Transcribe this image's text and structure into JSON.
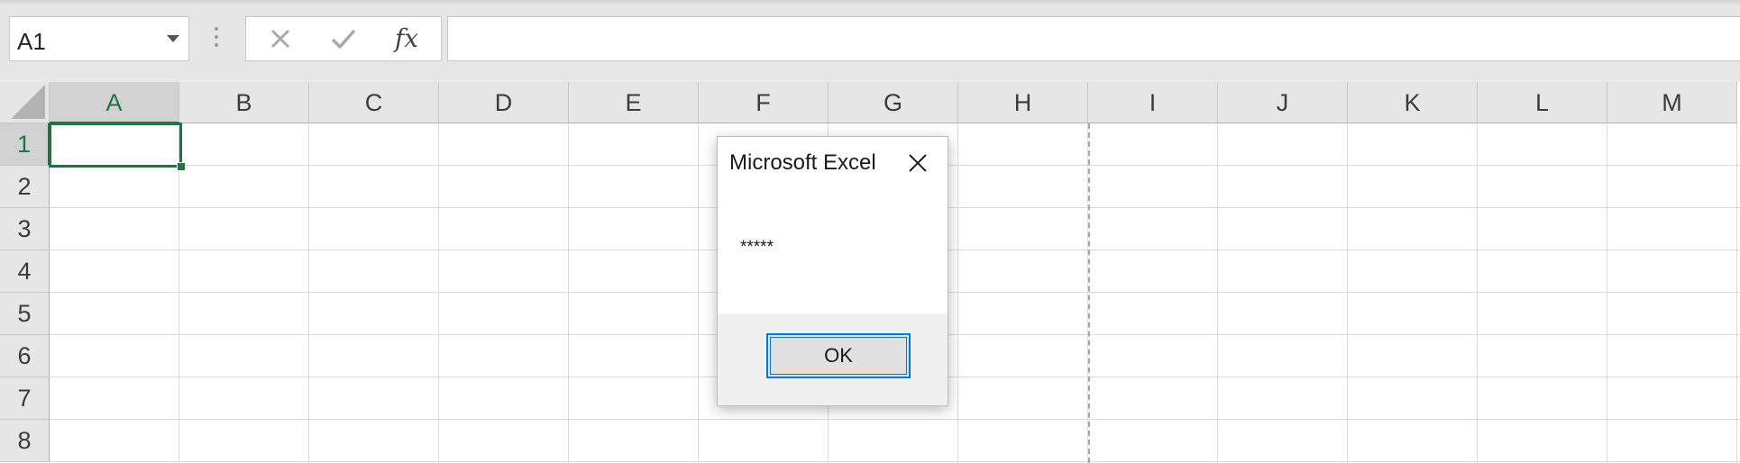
{
  "formula_bar": {
    "name_box_value": "A1",
    "cancel_icon": "close-icon",
    "enter_icon": "check-icon",
    "function_label": "fx",
    "formula_value": ""
  },
  "grid": {
    "columns": [
      "A",
      "B",
      "C",
      "D",
      "E",
      "F",
      "G",
      "H",
      "I",
      "J",
      "K",
      "L",
      "M"
    ],
    "rows": [
      "1",
      "2",
      "3",
      "4",
      "5",
      "6",
      "7",
      "8"
    ],
    "active_cell": "A1",
    "accent_color": "#217346"
  },
  "dialog": {
    "title": "Microsoft Excel",
    "message": "*****",
    "ok_label": "OK",
    "button_border_color": "#0078d7"
  }
}
